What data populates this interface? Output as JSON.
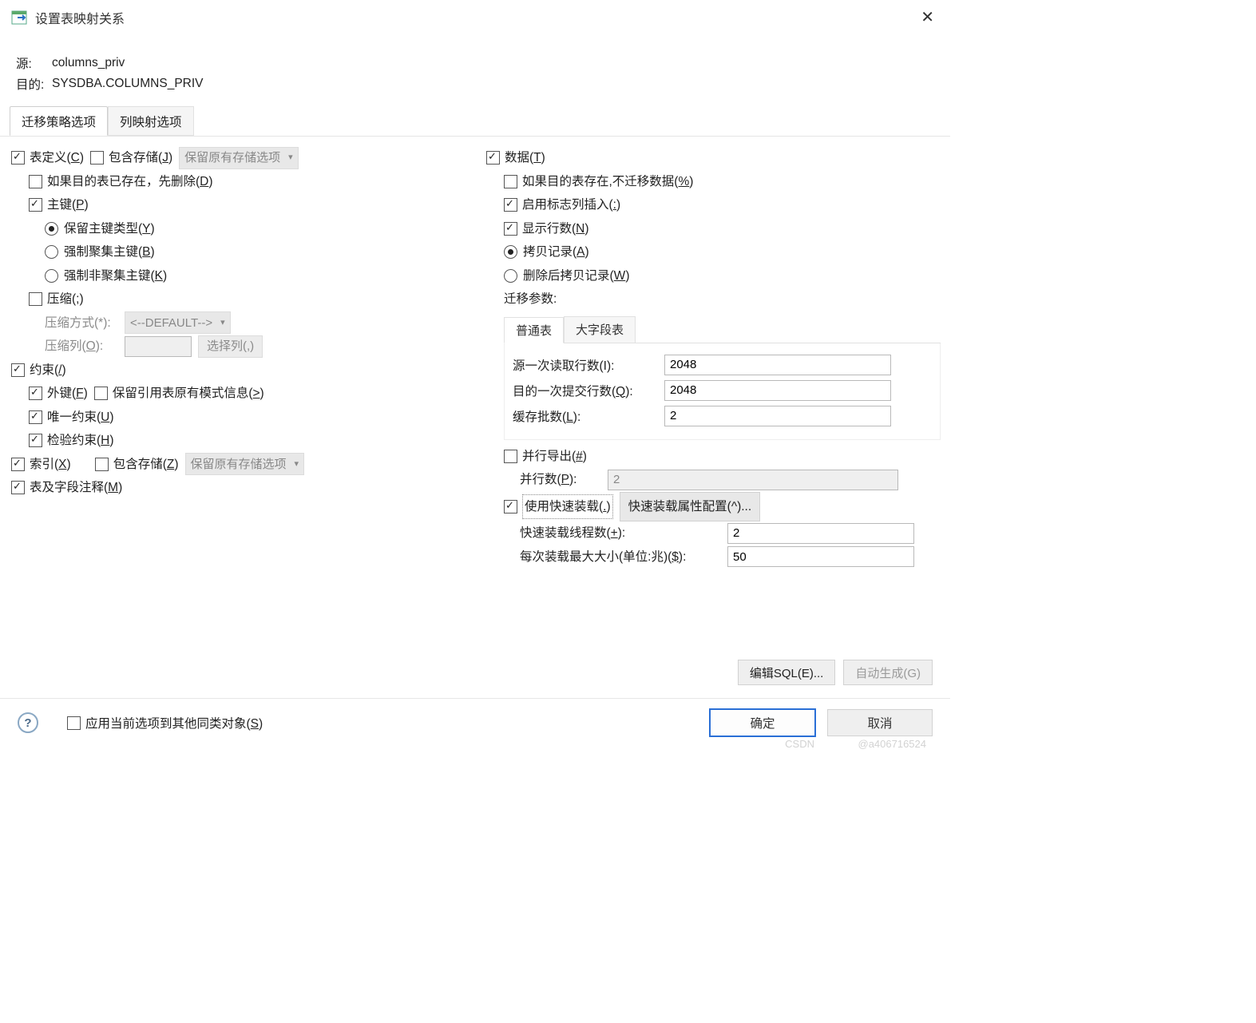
{
  "title": "设置表映射关系",
  "header": {
    "source_lbl": "源:",
    "source_val": "columns_priv",
    "target_lbl": "目的:",
    "target_val": "SYSDBA.COLUMNS_PRIV"
  },
  "tabs": {
    "strategy": "迁移策略选项",
    "colmap": "列映射选项"
  },
  "left": {
    "table_def": {
      "label": "表定义(",
      "hot": "C",
      "tail": ")"
    },
    "inc_store": {
      "label": "包含存储(",
      "hot": "J",
      "tail": ")"
    },
    "store_combo": "保留原有存储选项",
    "drop_if_exist": {
      "label": "如果目的表已存在，先删除(",
      "hot": "D",
      "tail": ")"
    },
    "pk": {
      "label": "主键(",
      "hot": "P",
      "tail": ")"
    },
    "pk_keep": {
      "label": "保留主键类型(",
      "hot": "Y",
      "tail": ")"
    },
    "pk_clust": {
      "label": "强制聚集主键(",
      "hot": "B",
      "tail": ")"
    },
    "pk_nonclust": {
      "label": "强制非聚集主键(",
      "hot": "K",
      "tail": ")"
    },
    "compress": {
      "label": "压缩(",
      "hot": ";",
      "tail": ")"
    },
    "comp_method_lbl": "压缩方式(*):",
    "comp_method_val": "<--DEFAULT-->",
    "comp_col_lbl": {
      "label": "压缩列(",
      "hot": "O",
      "tail": "):"
    },
    "comp_col_btn": "选择列(,)",
    "constraint": {
      "label": "约束(",
      "hot": "/",
      "tail": ")"
    },
    "fk": {
      "label": "外键(",
      "hot": "F",
      "tail": ")"
    },
    "keep_ref": {
      "label": "保留引用表原有模式信息(",
      "hot": ">",
      "tail": ")"
    },
    "unique": {
      "label": "唯一约束(",
      "hot": "U",
      "tail": ")"
    },
    "check": {
      "label": "检验约束(",
      "hot": "H",
      "tail": ")"
    },
    "index": {
      "label": "索引(",
      "hot": "X",
      "tail": ")"
    },
    "idx_inc_store": {
      "label": "包含存储(",
      "hot": "Z",
      "tail": ")"
    },
    "idx_store_combo": "保留原有存储选项",
    "comments": {
      "label": "表及字段注释(",
      "hot": "M",
      "tail": ")"
    }
  },
  "right": {
    "data": {
      "label": "数据(",
      "hot": "T",
      "tail": ")"
    },
    "skip_if_exist": {
      "label": "如果目的表存在,不迁移数据(",
      "hot": "%",
      "tail": ")"
    },
    "identity": {
      "label": "启用标志列插入(",
      "hot": ":",
      "tail": ")"
    },
    "showrows": {
      "label": "显示行数(",
      "hot": "N",
      "tail": ")"
    },
    "copy": {
      "label": "拷贝记录(",
      "hot": "A",
      "tail": ")"
    },
    "del_copy": {
      "label": "删除后拷贝记录(",
      "hot": "W",
      "tail": ")"
    },
    "mig_params": "迁移参数:",
    "subtabs": {
      "normal": "普通表",
      "lob": "大字段表"
    },
    "p_read": {
      "label": "源一次读取行数(I):",
      "val": "2048"
    },
    "p_commit": {
      "label": "目的一次提交行数(",
      "hot": "Q",
      "tail": "):",
      "val": "2048"
    },
    "p_cache": {
      "label": "缓存批数(",
      "hot": "L",
      "tail": "):",
      "val": "2"
    },
    "parallel": {
      "label": "并行导出(",
      "hot": "#",
      "tail": ")"
    },
    "paral_n": {
      "label": "并行数(",
      "hot": "P",
      "tail": "):",
      "val": "2"
    },
    "fastload": {
      "label": "使用快速装载(",
      "hot": ".",
      "tail": ")"
    },
    "fastload_cfg": "快速装载属性配置(^)...",
    "fast_threads": {
      "label": "快速装载线程数(",
      "hot": "+",
      "tail": "):",
      "val": "2"
    },
    "max_size": {
      "label": "每次装载最大大小(单位:兆)(",
      "hot": "$",
      "tail": "):",
      "val": "50"
    }
  },
  "edit_sql": "编辑SQL(E)...",
  "auto_gen": "自动生成(G)",
  "apply_all": {
    "label": "应用当前选项到其他同类对象(",
    "hot": "S",
    "tail": ")"
  },
  "ok": "确定",
  "cancel": "取消",
  "wm1": "CSDN",
  "wm2": "@a406716524"
}
